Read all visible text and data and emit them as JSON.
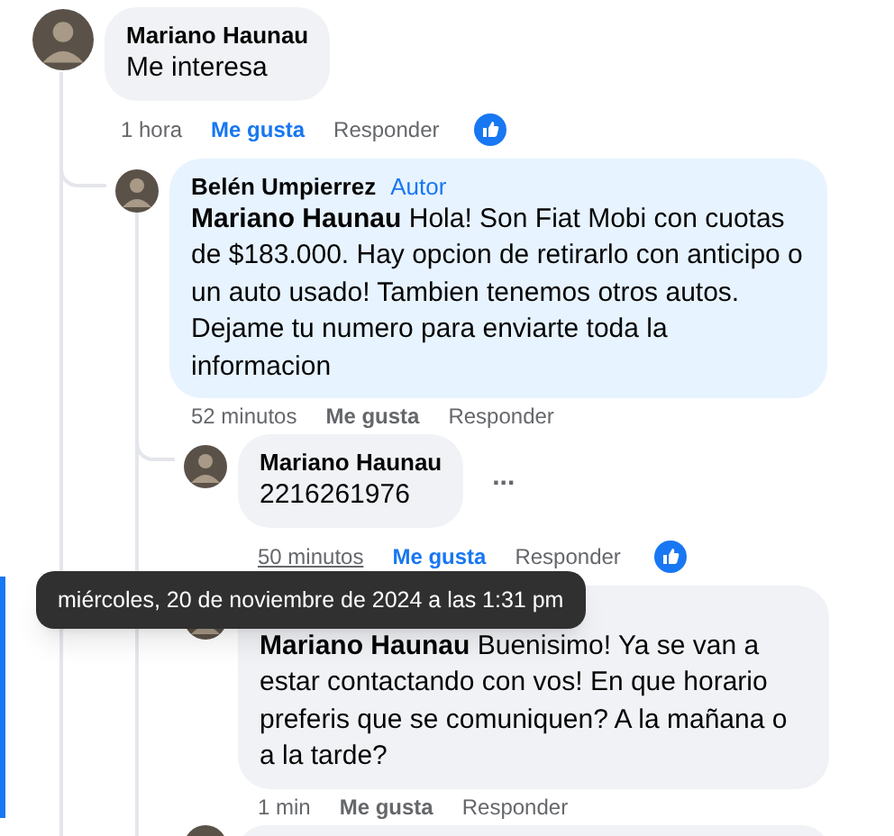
{
  "comments": [
    {
      "kind": "comment",
      "author": "Mariano Haunau",
      "text": "Me interesa",
      "highlighted": false,
      "time": "1 hora",
      "time_hovered": false,
      "like_label": "Me gusta",
      "liked": true,
      "reply_label": "Responder",
      "reacted": true,
      "children": [
        {
          "kind": "comment",
          "author": "Belén Umpierrez",
          "badge": "Autor",
          "mention": "Mariano Haunau",
          "text": "Hola! Son Fiat Mobi con cuotas de $183.000. Hay opcion de retirarlo con anticipo o un auto usado! Tambien tenemos otros autos. Dejame tu numero para enviarte toda la informacion",
          "highlighted": true,
          "time": "52 minutos",
          "time_hovered": false,
          "like_label": "Me gusta",
          "liked": false,
          "reply_label": "Responder",
          "reacted": false,
          "children": [
            {
              "kind": "comment",
              "author": "Mariano Haunau",
              "text": "2216261976",
              "highlighted": false,
              "time": "50 minutos",
              "time_hovered": true,
              "like_label": "Me gusta",
              "liked": true,
              "reply_label": "Responder",
              "reacted": true,
              "more_label": "...",
              "tooltip": "miércoles, 20 de noviembre de 2024 a las 1:31 pm"
            },
            {
              "kind": "comment",
              "mention": "Mariano Haunau",
              "text": "Buenisimo! Ya se van a estar contactando con vos! En que horario preferis que se comuniquen? A la mañana o a la tarde?",
              "highlighted": false,
              "time": "1 min",
              "time_hovered": false,
              "like_label": "Me gusta",
              "liked": false,
              "reply_label": "Responder",
              "reacted": false,
              "focused": true
            },
            {
              "kind": "cut"
            }
          ]
        }
      ]
    }
  ]
}
